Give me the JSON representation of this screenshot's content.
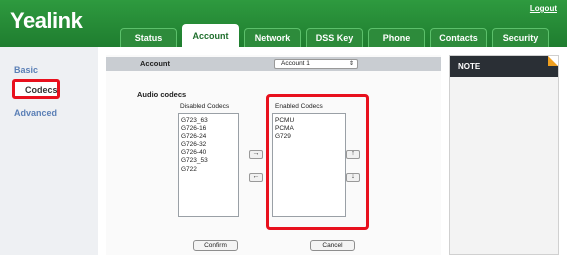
{
  "brand": {
    "name": "Yealink",
    "logout": "Logout"
  },
  "tabs": [
    {
      "label": "Status"
    },
    {
      "label": "Account",
      "active": true
    },
    {
      "label": "Network"
    },
    {
      "label": "DSS Key"
    },
    {
      "label": "Phone"
    },
    {
      "label": "Contacts"
    },
    {
      "label": "Security"
    }
  ],
  "sidebar": {
    "items": [
      {
        "label": "Basic"
      },
      {
        "label": "Codecs",
        "selected": true
      },
      {
        "label": "Advanced"
      }
    ]
  },
  "account": {
    "label": "Account",
    "selected": "Account 1"
  },
  "audio": {
    "title": "Audio codecs",
    "disabled_title": "Disabled Codecs",
    "enabled_title": "Enabled Codecs",
    "disabled": [
      "G723_63",
      "G726-16",
      "G726-24",
      "G726-32",
      "G726-40",
      "G723_53",
      "G722"
    ],
    "enabled": [
      "PCMU",
      "PCMA",
      "G729"
    ]
  },
  "buttons": {
    "confirm": "Confirm",
    "cancel": "Cancel"
  },
  "note": {
    "title": "NOTE"
  },
  "colors": {
    "header": "#1f7d2f",
    "highlight": "#e8101d",
    "sidebar_link": "#5a7fb6"
  },
  "icons": {
    "move_right": "→",
    "move_left": "←",
    "move_up": "↑",
    "move_down": "↓",
    "dropdown": "⇕"
  }
}
